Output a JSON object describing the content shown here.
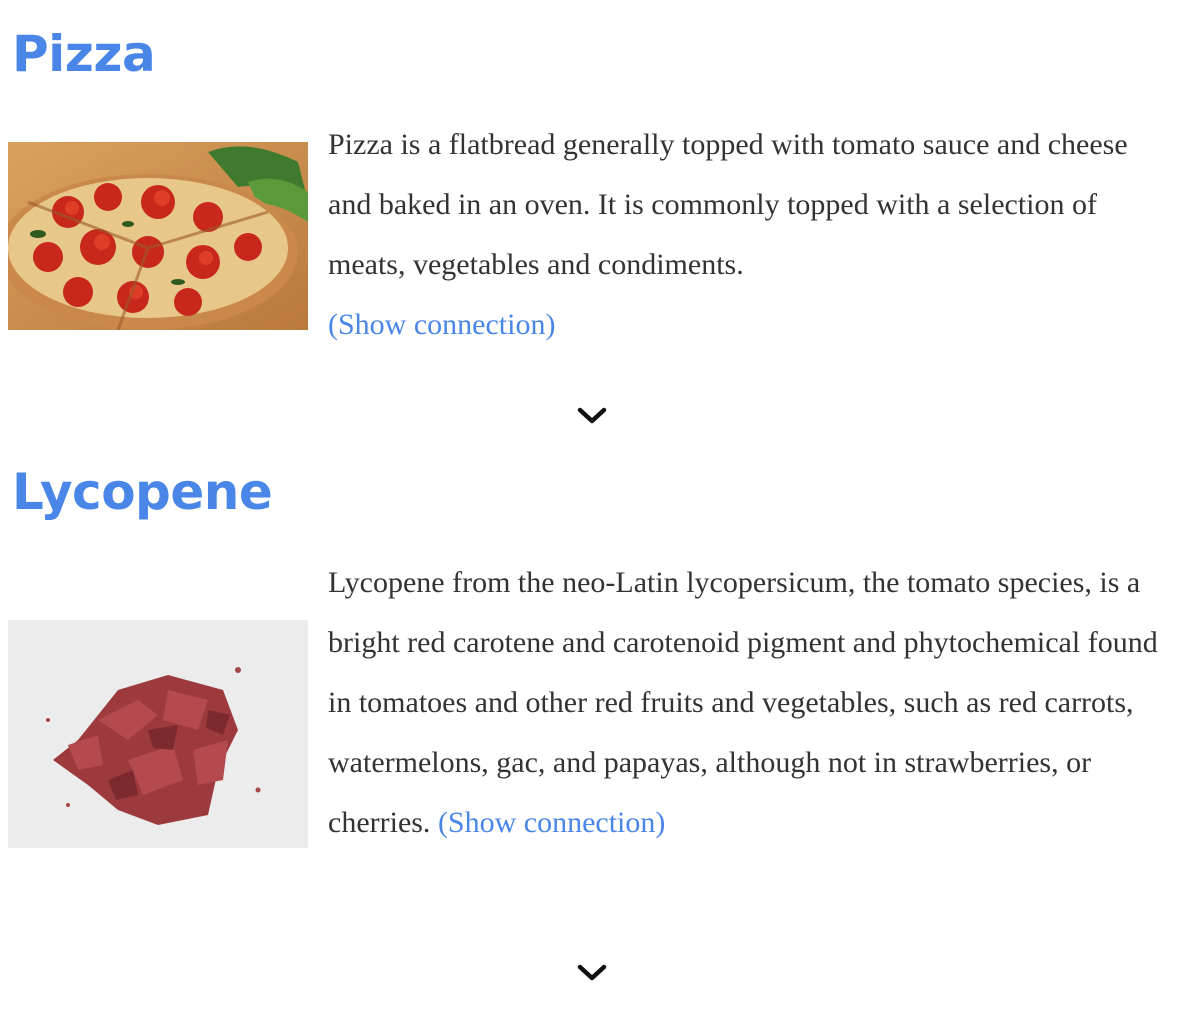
{
  "topics": [
    {
      "title": "Pizza",
      "description": "Pizza is a flatbread generally topped with tomato sauce and cheese and baked in an oven. It is commonly topped with a selection of meats, vegetables and condiments.",
      "link_label": "(Show connection)",
      "image_icon": "pizza-photo"
    },
    {
      "title": "Lycopene",
      "description": "Lycopene from the neo-Latin lycopersicum, the tomato species, is a bright red carotene and carotenoid pigment and phytochemical found in tomatoes and other red fruits and vegetables, such as red carrots, watermelons, gac, and papayas, although not in strawberries, or cherries.",
      "link_label": "(Show connection)",
      "image_icon": "lycopene-powder-photo"
    }
  ],
  "next_icon": "chevron-down-icon",
  "colors": {
    "title": "#4a86e8",
    "link": "#4a86e8",
    "body_text": "#333333"
  }
}
